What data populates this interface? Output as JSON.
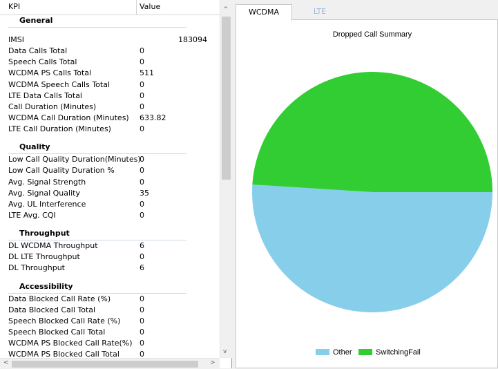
{
  "table": {
    "headers": {
      "kpi": "KPI",
      "value": "Value"
    },
    "groups": [
      {
        "title": "General",
        "rows": [
          {
            "name": "IMSI",
            "value": "183094"
          },
          {
            "name": "Data Calls Total",
            "value": "0"
          },
          {
            "name": "Speech Calls Total",
            "value": "0"
          },
          {
            "name": "WCDMA PS Calls Total",
            "value": "511"
          },
          {
            "name": "WCDMA Speech Calls Total",
            "value": "0"
          },
          {
            "name": "LTE Data Calls Total",
            "value": "0"
          },
          {
            "name": "Call Duration (Minutes)",
            "value": "0"
          },
          {
            "name": "WCDMA Call Duration (Minutes)",
            "value": "633.82"
          },
          {
            "name": "LTE Call Duration (Minutes)",
            "value": "0"
          }
        ]
      },
      {
        "title": "Quality",
        "rows": [
          {
            "name": "Low Call Quality Duration(Minutes)",
            "value": "0"
          },
          {
            "name": "Low Call Quality Duration %",
            "value": "0"
          },
          {
            "name": "Avg. Signal Strength",
            "value": "0"
          },
          {
            "name": "Avg. Signal Quality",
            "value": "35"
          },
          {
            "name": "Avg. UL Interference",
            "value": "0"
          },
          {
            "name": "LTE Avg. CQI",
            "value": "0"
          }
        ]
      },
      {
        "title": "Throughput",
        "rows": [
          {
            "name": "DL WCDMA Throughput",
            "value": "6"
          },
          {
            "name": "DL LTE Throughput",
            "value": "0"
          },
          {
            "name": "DL Throughput",
            "value": "6"
          }
        ]
      },
      {
        "title": "Accessibility",
        "rows": [
          {
            "name": "Data Blocked Call Rate (%)",
            "value": "0"
          },
          {
            "name": "Data Blocked Call Total",
            "value": "0"
          },
          {
            "name": "Speech Blocked Call Rate (%)",
            "value": "0"
          },
          {
            "name": "Speech Blocked Call Total",
            "value": "0"
          },
          {
            "name": "WCDMA PS Blocked Call Rate(%)",
            "value": "0"
          },
          {
            "name": "WCDMA PS Blocked Call Total",
            "value": "0"
          }
        ]
      }
    ]
  },
  "scroll_arrows": {
    "up": "^",
    "down": "v",
    "left": "<",
    "right": ">"
  },
  "tabs": [
    "WCDMA",
    "LTE"
  ],
  "chart_data": {
    "type": "pie",
    "title": "Dropped Call Summary",
    "slices": [
      {
        "label": "Other",
        "value": 51,
        "color": "#87ceeb"
      },
      {
        "label": "SwitchingFail",
        "value": 49,
        "color": "#32cd32"
      }
    ],
    "legend": "bottom"
  }
}
